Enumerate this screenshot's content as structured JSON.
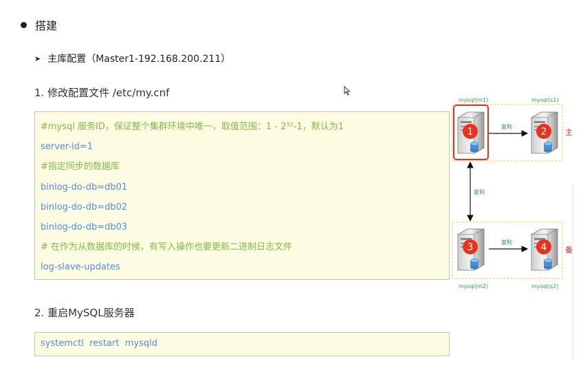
{
  "heading": "搭建",
  "subheading": "主库配置（Master1-192.168.200.211）",
  "step1": "1. 修改配置文件 /etc/my.cnf",
  "config_lines": [
    {
      "type": "comment",
      "text": "#mysql 服务ID，保证整个集群环境中唯一，取值范围：1 - 2³²-1，默认为1"
    },
    {
      "type": "code",
      "text": "server-id=1"
    },
    {
      "type": "comment",
      "text": "#指定同步的数据库"
    },
    {
      "type": "code",
      "text": "binlog-do-db=db01"
    },
    {
      "type": "code",
      "text": "binlog-do-db=db02"
    },
    {
      "type": "code",
      "text": "binlog-do-db=db03"
    },
    {
      "type": "comment",
      "text": "# 在作为从数据库的时候，有写入操作也要更新二进制日志文件"
    },
    {
      "type": "code",
      "text": "log-slave-updates"
    }
  ],
  "step2": "2. 重启MySQL服务器",
  "restart_command": "systemctl  restart  mysqld",
  "diagram": {
    "nodes": [
      {
        "label": "mysql(m1)",
        "number": "1"
      },
      {
        "label": "mysql(s1)",
        "number": "2"
      },
      {
        "label": "mysql(m2)",
        "number": "3"
      },
      {
        "label": "mysql(s2)",
        "number": "4"
      }
    ],
    "copy_label": "复制",
    "side_label_top": "主",
    "side_label_bottom": "备",
    "colors": {
      "label": "#2e9b4e",
      "badge": "#e8321d",
      "highlight": "#e8321d",
      "dashed": "#f3d27a"
    }
  }
}
